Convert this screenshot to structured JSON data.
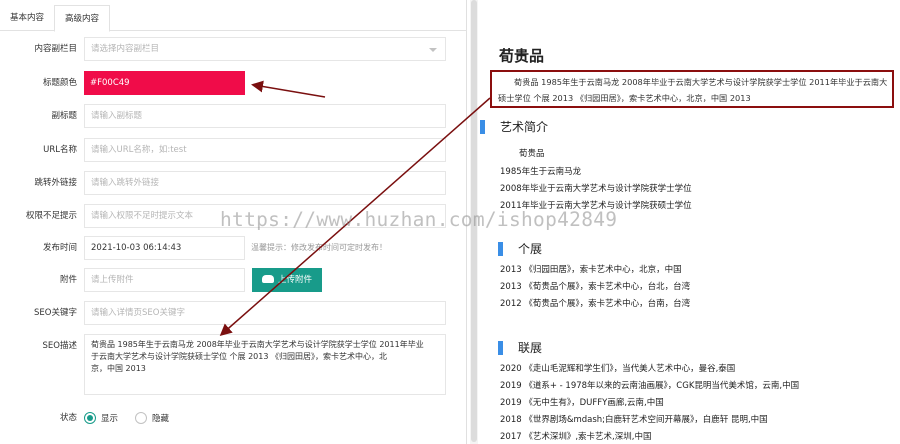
{
  "tabs": [
    "基本内容",
    "高级内容"
  ],
  "form": {
    "column": {
      "label": "内容副栏目",
      "placeholder": "请选择内容副栏目"
    },
    "title_color": {
      "label": "标题颜色",
      "value": "#F00C49"
    },
    "subtitle": {
      "label": "副标题",
      "placeholder": "请输入副标题"
    },
    "url_name": {
      "label": "URL名称",
      "placeholder": "请输入URL名称，如:test"
    },
    "external_link": {
      "label": "跳转外链接",
      "placeholder": "请输入跳转外链接"
    },
    "no_permission": {
      "label": "权限不足提示",
      "placeholder": "请输入权限不足时提示文本"
    },
    "publish_time": {
      "label": "发布时间",
      "value": "2021-10-03 06:14:43",
      "hint": "温馨提示：修改发布时间可定时发布！"
    },
    "attachment": {
      "label": "附件",
      "placeholder": "请上传附件",
      "button": "上传附件"
    },
    "seo_keywords": {
      "label": "SEO关键字",
      "placeholder": "请输入详情页SEO关键字"
    },
    "seo_description": {
      "label": "SEO描述",
      "line1": "荀贵品 1985年生于云南马龙 2008年毕业于云南大学艺术与设计学院获学士学位 2011年毕业",
      "line2": "于云南大学艺术与设计学院获硕士学位 个展 2013 《归园田居》，索卡艺术中心，北",
      "line3": "京，中国 2013"
    },
    "status": {
      "label": "状态",
      "show": "显示",
      "hide": "隐藏"
    }
  },
  "preview": {
    "title": "荀贵品",
    "seo_line1": "荀贵品 1985年生于云南马龙 2008年毕业于云南大学艺术与设计学院获学士学位 2011年毕业于云南大",
    "seo_line2": "硕士学位 个展 2013 《归园田居》，索卡艺术中心，北京，中国 2013",
    "intro_heading": "艺术简介",
    "intro": [
      "荀贵品",
      "1985年生于云南马龙",
      "2008年毕业于云南大学艺术与设计学院获学士学位",
      "2011年毕业于云南大学艺术与设计学院获硕士学位"
    ],
    "solo_heading": "个展",
    "solo": [
      "2013 《归园田居》，索卡艺术中心，北京，中国",
      "2013 《荀贵品个展》，索卡艺术中心，台北，台湾",
      "2012 《荀贵品个展》，索卡艺术中心，台南，台湾"
    ],
    "group_heading": "联展",
    "group": [
      "2020 《走山毛泥辉和学生们》，当代美人艺术中心，曼谷,泰国",
      "2019 《道系+ - 1978年以来的云南油画展》，CGK昆明当代美术馆，云南,中国",
      "2019 《无中生有》，DUFFY画廊,云南,中国",
      "2018 《世界剧场&mdash;白鹿轩艺术空间开幕展》，白鹿轩 昆明,中国",
      "2017 《艺术深圳》,索卡艺术,深圳,中国"
    ]
  },
  "watermark": "https://www.huzhan.com/ishop42849"
}
